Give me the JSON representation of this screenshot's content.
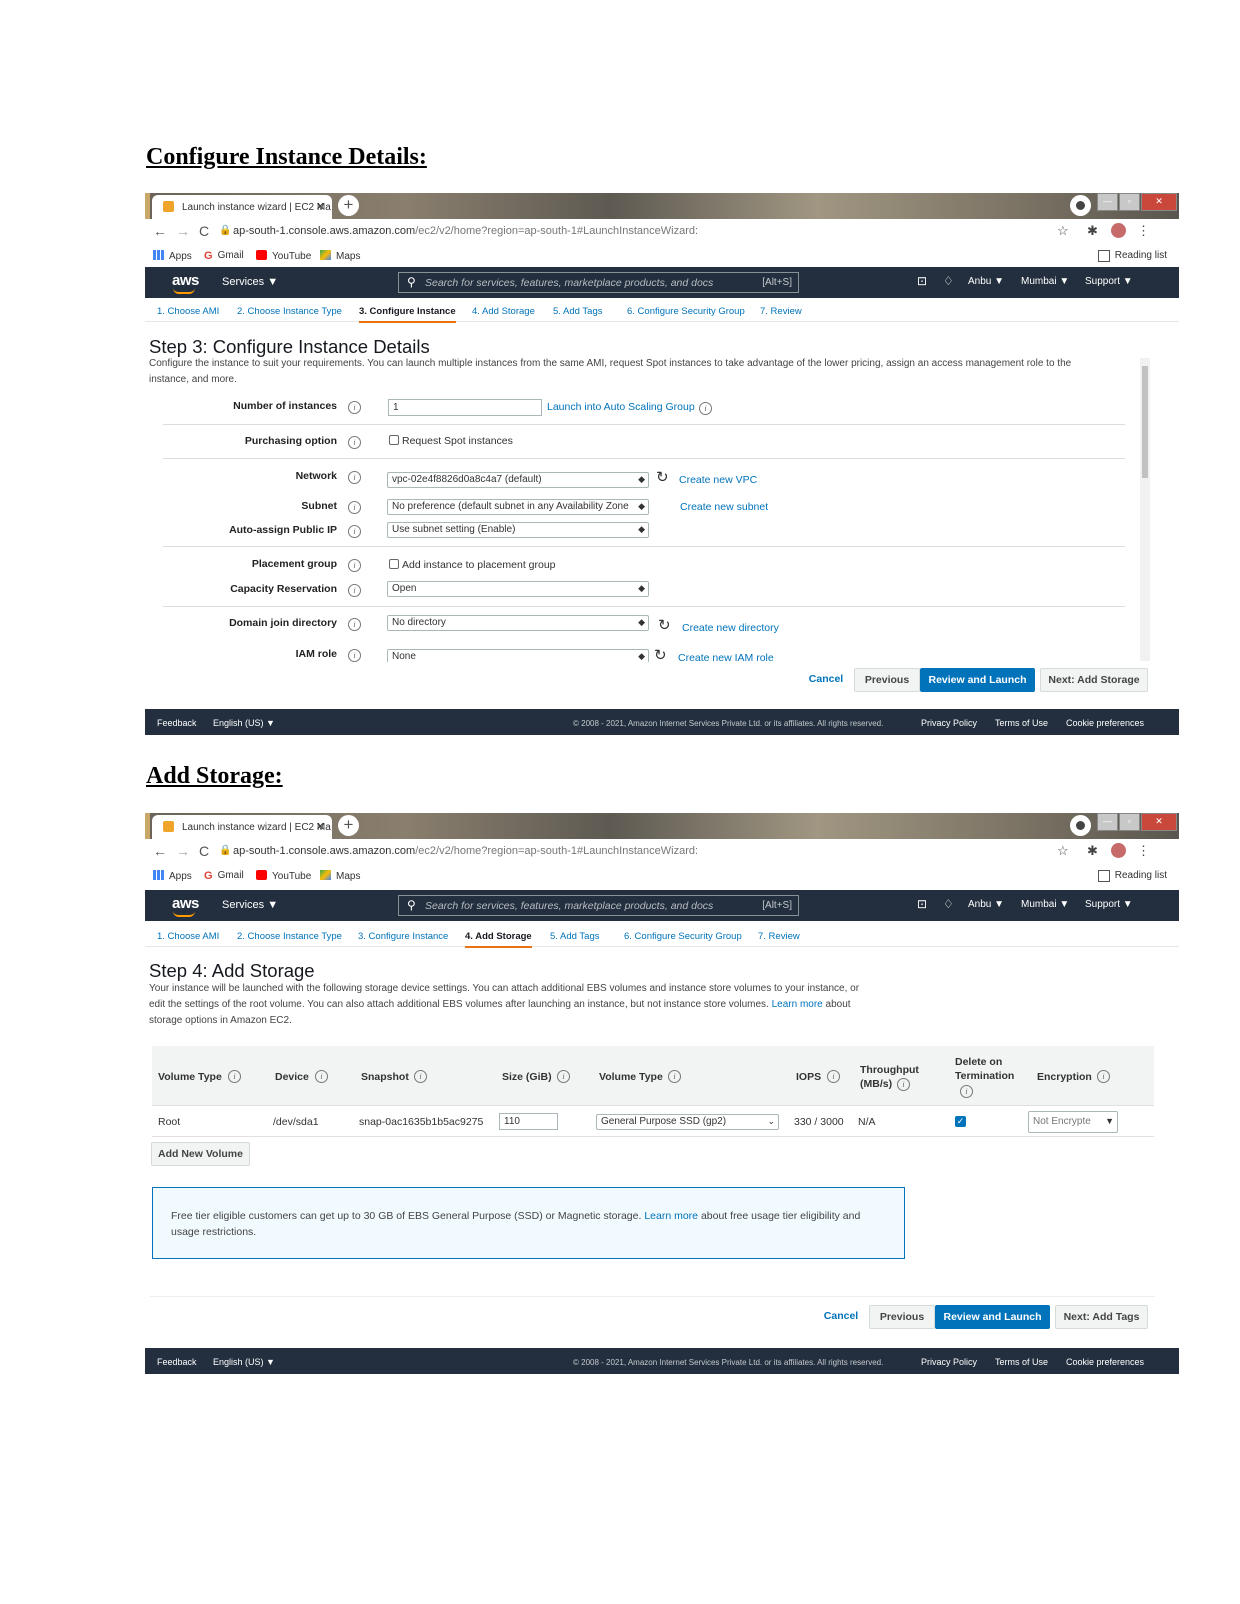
{
  "headings": {
    "configure": "Configure Instance Details:",
    "storage": "Add Storage:"
  },
  "browser": {
    "tab_title": "Launch instance wizard | EC2 Ma",
    "url_host": "ap-south-1.console.aws.amazon.com",
    "url_path": "/ec2/v2/home?region=ap-south-1#LaunchInstanceWizard:",
    "bookmarks": [
      "Apps",
      "Gmail",
      "YouTube",
      "Maps"
    ],
    "reading_list": "Reading list"
  },
  "aws": {
    "logo": "aws",
    "services": "Services ▼",
    "search_placeholder": "Search for services, features, marketplace products, and docs",
    "search_shortcut": "[Alt+S]",
    "user": "Anbu ▼",
    "region": "Mumbai ▼",
    "support": "Support ▼"
  },
  "wizard_steps": [
    "1. Choose AMI",
    "2. Choose Instance Type",
    "3. Configure Instance",
    "4. Add Storage",
    "5. Add Tags",
    "6. Configure Security Group",
    "7. Review"
  ],
  "step3": {
    "title": "Step 3: Configure Instance Details",
    "desc_line1": "Configure the instance to suit your requirements. You can launch multiple instances from the same AMI, request Spot instances to take advantage of the lower pricing, assign an access management role to the",
    "desc_line2": "instance, and more.",
    "fields": {
      "num_instances_label": "Number of instances",
      "num_instances_value": "1",
      "auto_scaling_link": "Launch into Auto Scaling Group",
      "purchasing_label": "Purchasing option",
      "spot_label": "Request Spot instances",
      "network_label": "Network",
      "network_value": "vpc-02e4f8826d0a8c4a7 (default)",
      "create_vpc": "Create new VPC",
      "subnet_label": "Subnet",
      "subnet_value": "No preference (default subnet in any Availability Zone",
      "create_subnet": "Create new subnet",
      "public_ip_label": "Auto-assign Public IP",
      "public_ip_value": "Use subnet setting (Enable)",
      "placement_label": "Placement group",
      "placement_check": "Add instance to placement group",
      "capacity_label": "Capacity Reservation",
      "capacity_value": "Open",
      "domain_label": "Domain join directory",
      "domain_value": "No directory",
      "create_directory": "Create new directory",
      "iam_label": "IAM role",
      "iam_value": "None",
      "create_iam": "Create new IAM role"
    },
    "buttons": {
      "cancel": "Cancel",
      "previous": "Previous",
      "review": "Review and Launch",
      "next": "Next: Add Storage"
    }
  },
  "step4": {
    "title": "Step 4: Add Storage",
    "desc_line1": "Your instance will be launched with the following storage device settings. You can attach additional EBS volumes and instance store volumes to your instance, or",
    "desc_line2a": "edit the settings of the root volume. You can also attach additional EBS volumes after launching an instance, but not instance store volumes.",
    "desc_learn": "Learn more",
    "desc_line2b": "about",
    "desc_line3": "storage options in Amazon EC2.",
    "table": {
      "headers": [
        "Volume Type",
        "Device",
        "Snapshot",
        "Size (GiB)",
        "Volume Type",
        "IOPS",
        "Throughput (MB/s)",
        "Delete on Termination",
        "Encryption"
      ],
      "row": {
        "volume_type": "Root",
        "device": "/dev/sda1",
        "snapshot": "snap-0ac1635b1b5ac9275",
        "size": "110",
        "type": "General Purpose SSD (gp2)",
        "iops": "330 / 3000",
        "throughput": "N/A",
        "encryption": "Not Encrypte"
      }
    },
    "add_volume": "Add New Volume",
    "notice_a": "Free tier eligible customers can get up to 30 GB of EBS General Purpose (SSD) or Magnetic storage.",
    "notice_link": "Learn more",
    "notice_b": "about free usage tier eligibility and",
    "notice_c": "usage restrictions.",
    "buttons": {
      "cancel": "Cancel",
      "previous": "Previous",
      "review": "Review and Launch",
      "next": "Next: Add Tags"
    }
  },
  "footer": {
    "feedback": "Feedback",
    "language": "English (US) ▼",
    "copyright": "© 2008 - 2021, Amazon Internet Services Private Ltd. or its affiliates. All rights reserved.",
    "privacy": "Privacy Policy",
    "terms": "Terms of Use",
    "cookies": "Cookie preferences"
  },
  "colors": {
    "aws_nav": "#232f3e",
    "link": "#0073bb",
    "accent": "#ec7211"
  }
}
